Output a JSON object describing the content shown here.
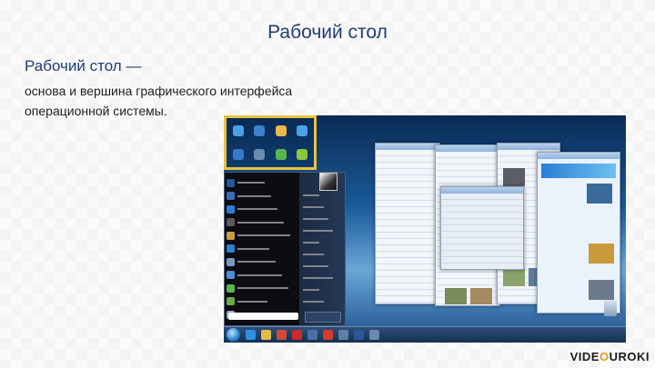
{
  "slide": {
    "title": "Рабочий стол",
    "heading": "Рабочий стол —",
    "description_line1": "основа и вершина графического интерфейса",
    "description_line2": "операционной системы."
  },
  "brand": {
    "part1": "VIDE",
    "part2": "O",
    "part3": "UROKI"
  },
  "colors": {
    "title": "#1f3f73",
    "highlight_border": "#e9c244",
    "brand_accent": "#e5a020"
  },
  "screenshot": {
    "desktop_icons": [
      {
        "icon": "computer-icon",
        "color": "#4aa3e8"
      },
      {
        "icon": "network-icon",
        "color": "#3f7fd0"
      },
      {
        "icon": "folder-icon",
        "color": "#e8b84a"
      },
      {
        "icon": "documents-icon",
        "color": "#4aa3e8"
      },
      {
        "icon": "media-icon",
        "color": "#3a78c8"
      },
      {
        "icon": "app-icon",
        "color": "#6a8ab0"
      },
      {
        "icon": "globe-icon",
        "color": "#59b64a"
      },
      {
        "icon": "notes-icon",
        "color": "#8cc63f"
      }
    ],
    "start_menu_icons": [
      "word-icon",
      "app-icon",
      "app-icon",
      "app-icon",
      "paint-icon",
      "app-icon",
      "app-icon",
      "app-icon",
      "app-icon",
      "app-icon",
      "app-icon"
    ],
    "taskbar_icons": [
      "ie-icon",
      "folder-icon",
      "media-icon",
      "opera-icon",
      "app-icon",
      "pdf-icon",
      "app-icon",
      "word-icon",
      "app-icon"
    ]
  }
}
